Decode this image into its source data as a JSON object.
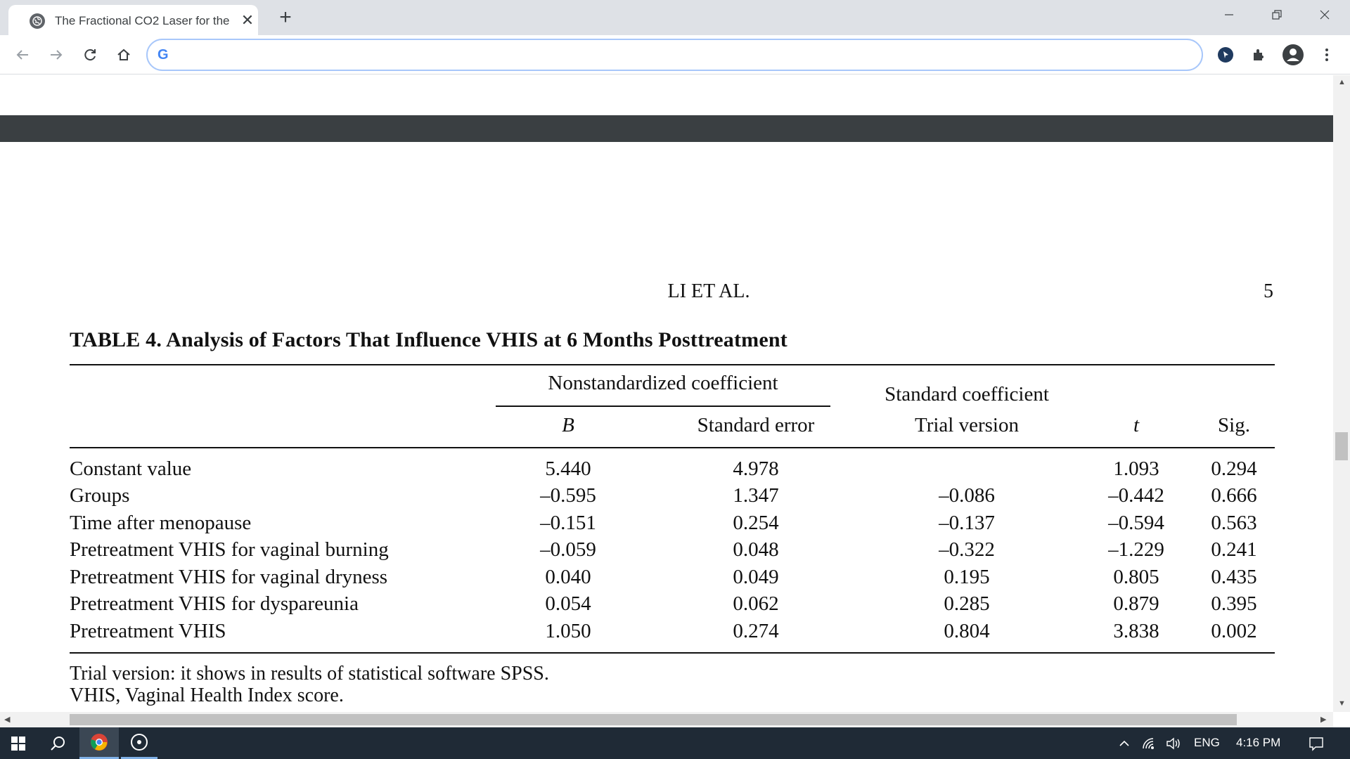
{
  "browser": {
    "tab_title": "The Fractional CO2 Laser for the",
    "tab_close": "✕",
    "new_tab": "+",
    "address_value": "",
    "google_logo": "G"
  },
  "document": {
    "running_head": "LI ET AL.",
    "page_number": "5",
    "table_title": "TABLE 4. Analysis of Factors That Influence VHIS at 6 Months Posttreatment",
    "header_group_nonstd": "Nonstandardized coefficient",
    "header_group_std": "Standard coefficient",
    "columns": {
      "b": "B",
      "se": "Standard error",
      "trial": "Trial version",
      "t": "t",
      "sig": "Sig."
    },
    "rows": [
      {
        "label": "Constant value",
        "b": "5.440",
        "se": "4.978",
        "trial": "",
        "t": "1.093",
        "sig": "0.294"
      },
      {
        "label": "Groups",
        "b": "–0.595",
        "se": "1.347",
        "trial": "–0.086",
        "t": "–0.442",
        "sig": "0.666"
      },
      {
        "label": "Time after menopause",
        "b": "–0.151",
        "se": "0.254",
        "trial": "–0.137",
        "t": "–0.594",
        "sig": "0.563"
      },
      {
        "label": "Pretreatment VHIS for vaginal burning",
        "b": "–0.059",
        "se": "0.048",
        "trial": "–0.322",
        "t": "–1.229",
        "sig": "0.241"
      },
      {
        "label": "Pretreatment VHIS for vaginal dryness",
        "b": "0.040",
        "se": "0.049",
        "trial": "0.195",
        "t": "0.805",
        "sig": "0.435"
      },
      {
        "label": "Pretreatment VHIS for dyspareunia",
        "b": "0.054",
        "se": "0.062",
        "trial": "0.285",
        "t": "0.879",
        "sig": "0.395"
      },
      {
        "label": "Pretreatment VHIS",
        "b": "1.050",
        "se": "0.274",
        "trial": "0.804",
        "t": "3.838",
        "sig": "0.002"
      }
    ],
    "footnotes": [
      "Trial version: it shows in results of statistical software SPSS.",
      "VHIS, Vaginal Health Index score."
    ]
  },
  "taskbar": {
    "language": "ENG",
    "time": "4:16 PM"
  },
  "colors": {
    "tabstrip": "#dee1e6",
    "taskbar": "#1f2a36",
    "dark_band": "#3a3f42",
    "omnibox_border": "#a8c7fa"
  }
}
